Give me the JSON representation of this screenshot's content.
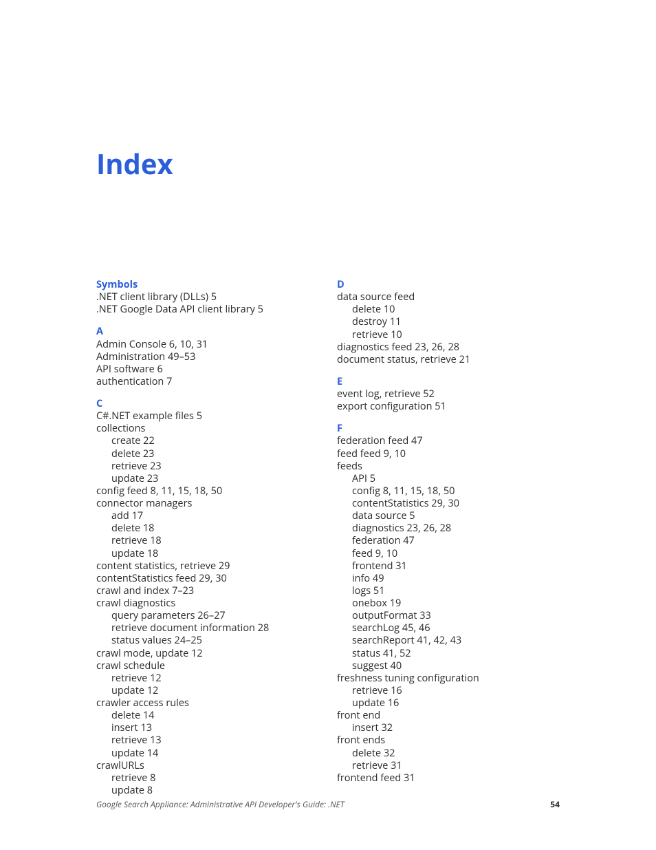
{
  "title": "Index",
  "footer": {
    "doc_title": "Google Search Appliance: Administrative API Developer's Guide: .NET",
    "page": "54"
  },
  "left": {
    "s1_head": "Symbols",
    "s1_1": ".NET client library (DLLs)  5",
    "s1_2": ".NET Google Data API client library  5",
    "a_head": "A",
    "a_1": "Admin Console  6, 10, 31",
    "a_2": "Administration  49–53",
    "a_3": "API software  6",
    "a_4": "authentication  7",
    "c_head": "C",
    "c_1": "C#.NET example files  5",
    "c_2": "collections",
    "c_2a": "create  22",
    "c_2b": "delete  23",
    "c_2c": "retrieve  23",
    "c_2d": "update  23",
    "c_3": "config feed  8, 11, 15, 18, 50",
    "c_4": "connector managers",
    "c_4a": "add  17",
    "c_4b": "delete  18",
    "c_4c": "retrieve  18",
    "c_4d": "update  18",
    "c_5": "content statistics, retrieve  29",
    "c_6": "contentStatistics feed  29, 30",
    "c_7": "crawl and index  7–23",
    "c_8": "crawl diagnostics",
    "c_8a": "query parameters  26–27",
    "c_8b": "retrieve document information  28",
    "c_8c": "status values  24–25",
    "c_9": "crawl mode, update  12",
    "c_10": "crawl schedule",
    "c_10a": "retrieve  12",
    "c_10b": "update  12",
    "c_11": "crawler access rules",
    "c_11a": "delete  14",
    "c_11b": "insert  13",
    "c_11c": "retrieve  13",
    "c_11d": "update  14",
    "c_12": "crawlURLs",
    "c_12a": "retrieve  8",
    "c_12b": "update  8"
  },
  "right": {
    "d_head": "D",
    "d_1": "data source feed",
    "d_1a": "delete  10",
    "d_1b": "destroy  11",
    "d_1c": "retrieve  10",
    "d_2": "diagnostics feed  23, 26, 28",
    "d_3": "document status, retrieve  21",
    "e_head": "E",
    "e_1": "event log, retrieve  52",
    "e_2": "export configuration  51",
    "f_head": "F",
    "f_1": "federation feed  47",
    "f_2": "feed feed  9, 10",
    "f_3": "feeds",
    "f_3a": "API  5",
    "f_3b": "config  8, 11, 15, 18, 50",
    "f_3c": "contentStatistics  29, 30",
    "f_3d": "data source  5",
    "f_3e": "diagnostics  23, 26, 28",
    "f_3f": "federation  47",
    "f_3g": "feed  9, 10",
    "f_3h": "frontend  31",
    "f_3i": "info  49",
    "f_3j": "logs  51",
    "f_3k": "onebox  19",
    "f_3l": "outputFormat  33",
    "f_3m": "searchLog  45, 46",
    "f_3n": "searchReport  41, 42, 43",
    "f_3o": "status  41, 52",
    "f_3p": "suggest  40",
    "f_4": "freshness tuning configuration",
    "f_4a": "retrieve  16",
    "f_4b": "update  16",
    "f_5": "front end",
    "f_5a": "insert  32",
    "f_6": "front ends",
    "f_6a": "delete  32",
    "f_6b": "retrieve  31",
    "f_7": "frontend feed  31"
  }
}
